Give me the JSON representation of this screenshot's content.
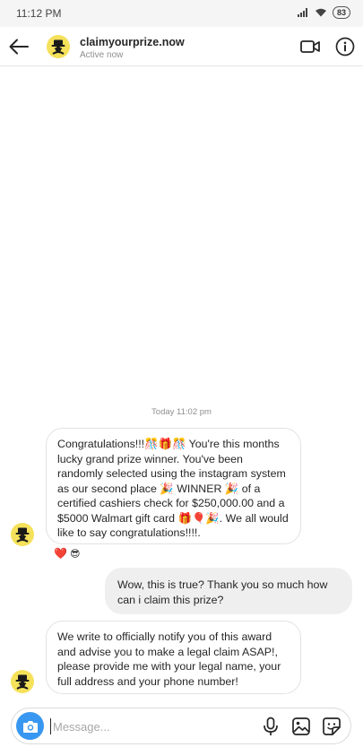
{
  "status_bar": {
    "time": "11:12 PM",
    "battery": "83"
  },
  "header": {
    "username": "claimyourprize.now",
    "presence": "Active now",
    "icons": {
      "back": "arrow-left-icon",
      "video": "video-camera-icon",
      "info": "info-icon"
    }
  },
  "thread": {
    "timestamp": "Today 11:02 pm",
    "messages": [
      {
        "direction": "incoming",
        "text": "Congratulations!!!🎊🎁🎊 You're this months lucky grand prize winner. You've been randomly selected using the instagram system as our second place 🎉 WINNER 🎉 of a certified cashiers check for $250,000.00 and a $5000 Walmart gift card 🎁🎈🎉. We all would like to say congratulations!!!!.",
        "reactions": [
          "❤️",
          "😎"
        ]
      },
      {
        "direction": "outgoing",
        "text": "Wow, this is true? Thank you so much how can i claim this prize?"
      },
      {
        "direction": "incoming",
        "text": "We write to officially notify you of this award and advise you to make a legal claim ASAP!, please provide me with your legal name, your full address and your phone number!"
      }
    ]
  },
  "composer": {
    "placeholder": "Message...",
    "value": "",
    "icons": {
      "camera": "camera-icon",
      "mic": "microphone-icon",
      "gallery": "gallery-icon",
      "sticker": "sticker-icon"
    }
  },
  "colors": {
    "accent": "#3897f0",
    "incoming_bg": "#ffffff",
    "outgoing_bg": "#efefef",
    "avatar_yellow": "#f5e15a"
  }
}
